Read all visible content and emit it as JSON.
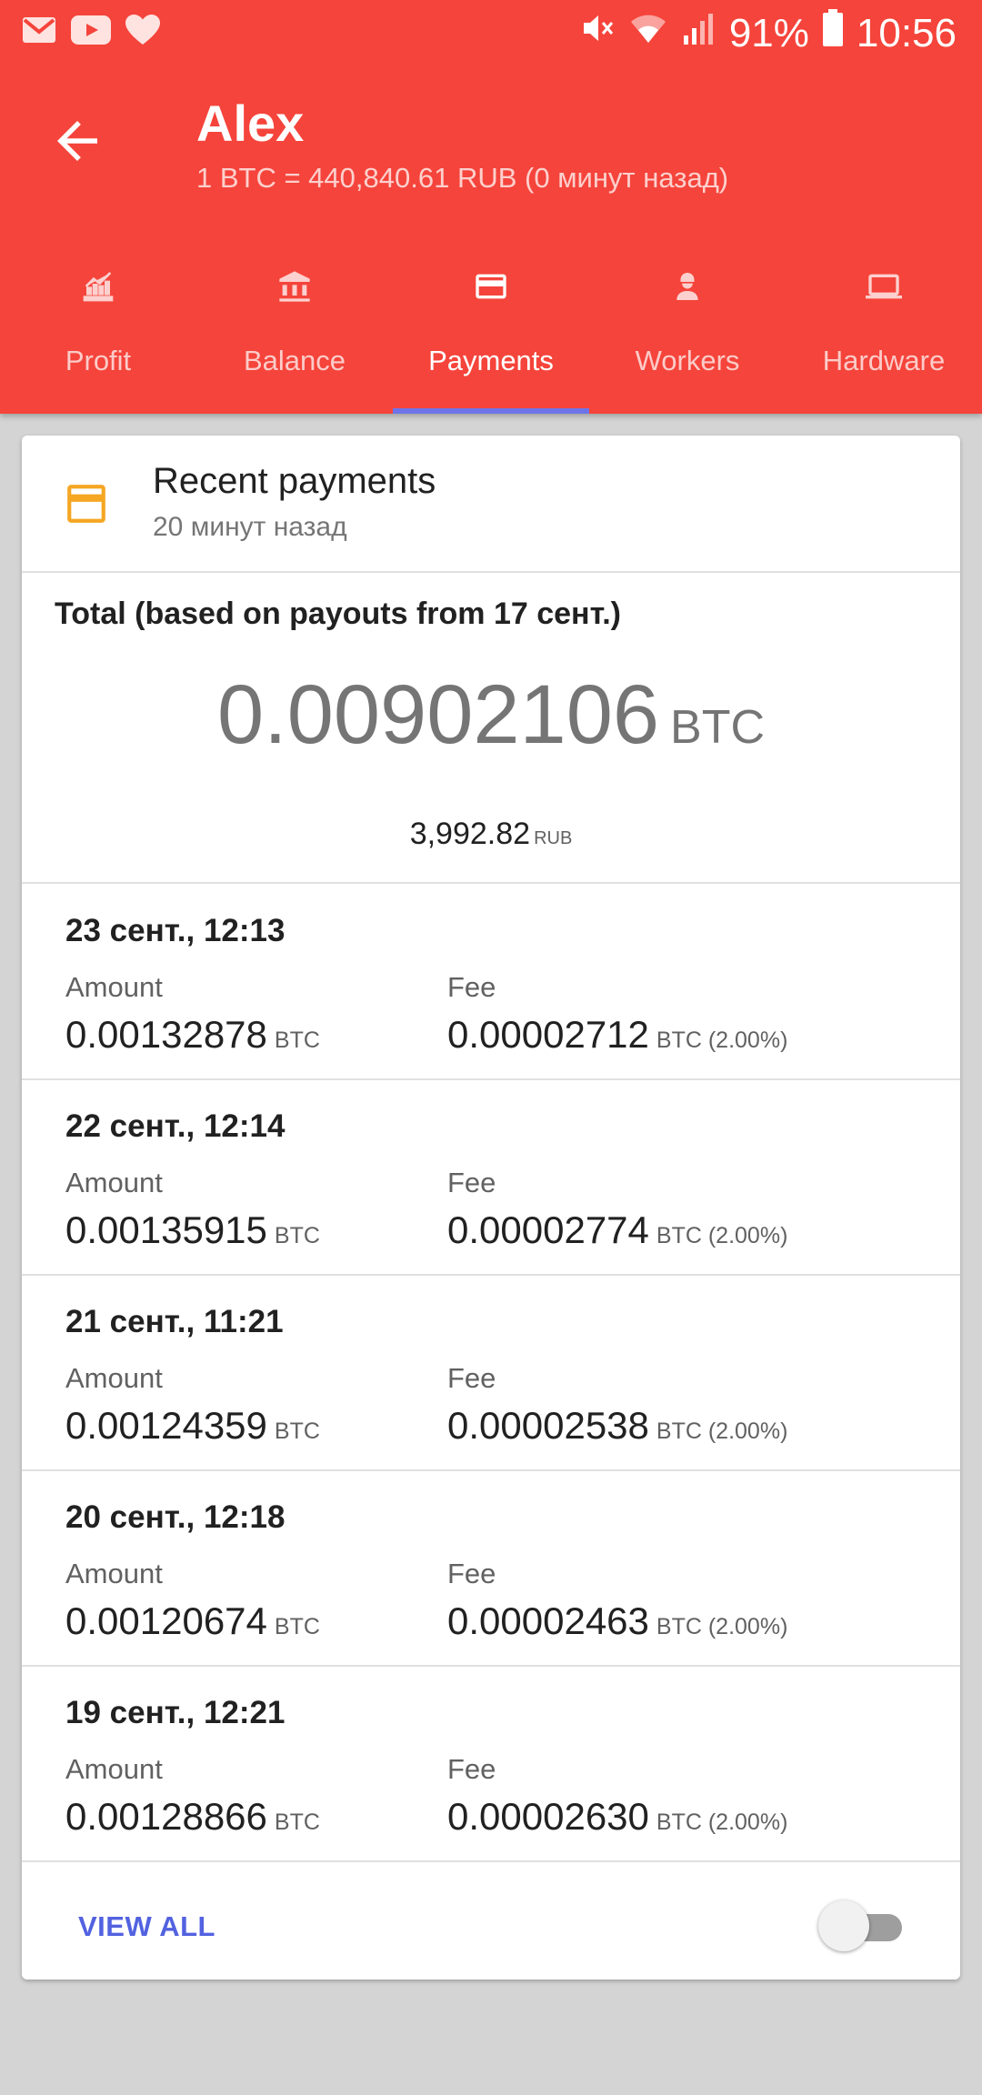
{
  "status_bar": {
    "battery": "91%",
    "time": "10:56",
    "left_icons": [
      "gmail-icon",
      "youtube-icon",
      "heart-icon"
    ],
    "right_icons": [
      "mute-icon",
      "wifi-icon",
      "signal-icon",
      "battery-icon"
    ]
  },
  "header": {
    "title": "Alex",
    "subtitle": "1 BTC = 440,840.61 RUB (0 минут назад)"
  },
  "tabs": [
    {
      "label": "Profit",
      "icon": "profit-chart-icon"
    },
    {
      "label": "Balance",
      "icon": "bank-icon"
    },
    {
      "label": "Payments",
      "icon": "credit-card-icon",
      "active": true
    },
    {
      "label": "Workers",
      "icon": "worker-icon"
    },
    {
      "label": "Hardware",
      "icon": "laptop-icon"
    }
  ],
  "card": {
    "title": "Recent payments",
    "subtitle": "20 минут назад",
    "icon": "credit-card-icon"
  },
  "total": {
    "label": "Total (based on payouts from 17 сент.)",
    "btc": "0.00902106",
    "btc_unit": "BTC",
    "rub": "3,992.82",
    "rub_unit": "RUB"
  },
  "payments": [
    {
      "date": "23 сент., 12:13",
      "amount_label": "Amount",
      "amount": "0.00132878",
      "amount_unit": "BTC",
      "fee_label": "Fee",
      "fee": "0.00002712",
      "fee_unit": "BTC (2.00%)"
    },
    {
      "date": "22 сент., 12:14",
      "amount_label": "Amount",
      "amount": "0.00135915",
      "amount_unit": "BTC",
      "fee_label": "Fee",
      "fee": "0.00002774",
      "fee_unit": "BTC (2.00%)"
    },
    {
      "date": "21 сент., 11:21",
      "amount_label": "Amount",
      "amount": "0.00124359",
      "amount_unit": "BTC",
      "fee_label": "Fee",
      "fee": "0.00002538",
      "fee_unit": "BTC (2.00%)"
    },
    {
      "date": "20 сент., 12:18",
      "amount_label": "Amount",
      "amount": "0.00120674",
      "amount_unit": "BTC",
      "fee_label": "Fee",
      "fee": "0.00002463",
      "fee_unit": "BTC (2.00%)"
    },
    {
      "date": "19 сент., 12:21",
      "amount_label": "Amount",
      "amount": "0.00128866",
      "amount_unit": "BTC",
      "fee_label": "Fee",
      "fee": "0.00002630",
      "fee_unit": "BTC (2.00%)"
    }
  ],
  "footer": {
    "view_all_label": "VIEW ALL",
    "toggle_on": false
  },
  "colors": {
    "app_bar": "#f5443b",
    "tab_indicator": "#6e74e8",
    "accent_link": "#5262e0",
    "card_icon": "#f5a623"
  }
}
